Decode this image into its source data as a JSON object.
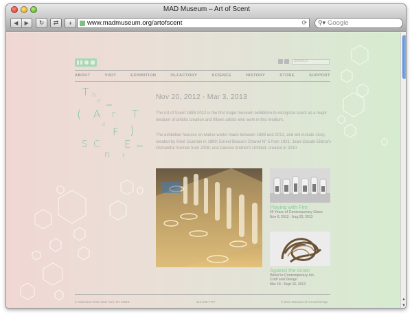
{
  "window": {
    "title": "MAD Museum – Art of Scent"
  },
  "toolbar": {
    "url": "www.madmuseum.org/artofscent",
    "search_placeholder": "Google"
  },
  "site": {
    "search_placeholder": "SEARCH",
    "nav": [
      "ABOUT",
      "VISIT",
      "EXHIBITION",
      "OLFACTORY",
      "SCIENCE",
      "HISTORY",
      "STORE",
      "SUPPORT"
    ]
  },
  "exhibition": {
    "title_letters": [
      "T",
      "h",
      "e",
      "(",
      "A",
      "r",
      "T",
      "o",
      "F",
      ")",
      "S",
      "C",
      "E",
      "n",
      "t"
    ],
    "title_tiny_1": "1889",
    "title_tiny_2": "2012",
    "dates": "Nov 20, 2012  -  Mar 3, 2013",
    "para1": "The Art of Scent 1889-2012 is the first major museum exhibition to recognize scent as a major medium of artistic creation and fifteen artists who work in this medium.",
    "para2": "The exhibition focuses on twelve works made between 1889 and 2012, and will include Jicky, created by Aimé Guerlain in 1889; Ernest Beaux's Chanel N° 5 from 1921; Jean-Claude Ellena's Osmanthe Yunnan from 2006; and Daniela Andrier's Untitled, created in 2010."
  },
  "related": [
    {
      "title": "Playing with Fire",
      "subtitle": "50 Years of Contemporary Glass",
      "dates": "Nov 6, 2012 - Aug 25, 2013"
    },
    {
      "title": "Against the Grain",
      "subtitle1": "Wood in Contemporary Art,",
      "subtitle2": "Craft and Design",
      "dates": "Mar 19 - Sept 15, 2013"
    }
  ],
  "footer": {
    "address": "2 Columbus Circle New York, NY 10019",
    "phone": "212.299.7777",
    "copyright": "© 2013 Museum of Art and Design"
  },
  "colors": {
    "accent_green": "#7fc3a0",
    "bg_left": "#f0d7d4",
    "bg_right": "#d5eccf"
  },
  "icons": [
    "back-icon",
    "forward-icon",
    "reload-icon",
    "share-icon",
    "add-icon",
    "search-icon",
    "facebook-icon",
    "twitter-icon"
  ]
}
